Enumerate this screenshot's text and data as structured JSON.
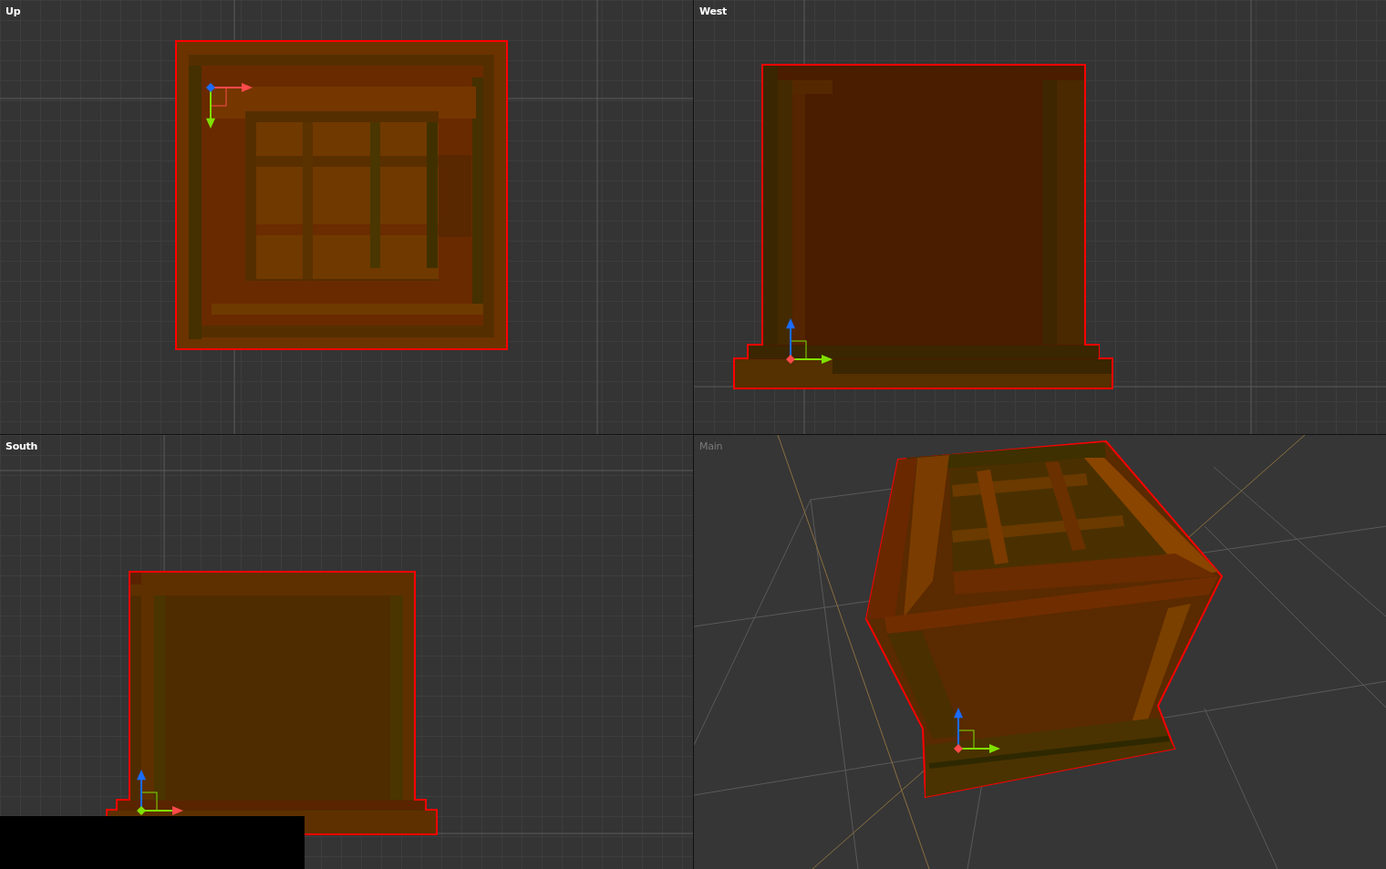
{
  "viewports": [
    {
      "label": "Up",
      "kind": "ortho"
    },
    {
      "label": "West",
      "kind": "ortho"
    },
    {
      "label": "South",
      "kind": "ortho"
    },
    {
      "label": "Main",
      "kind": "perspective"
    }
  ]
}
